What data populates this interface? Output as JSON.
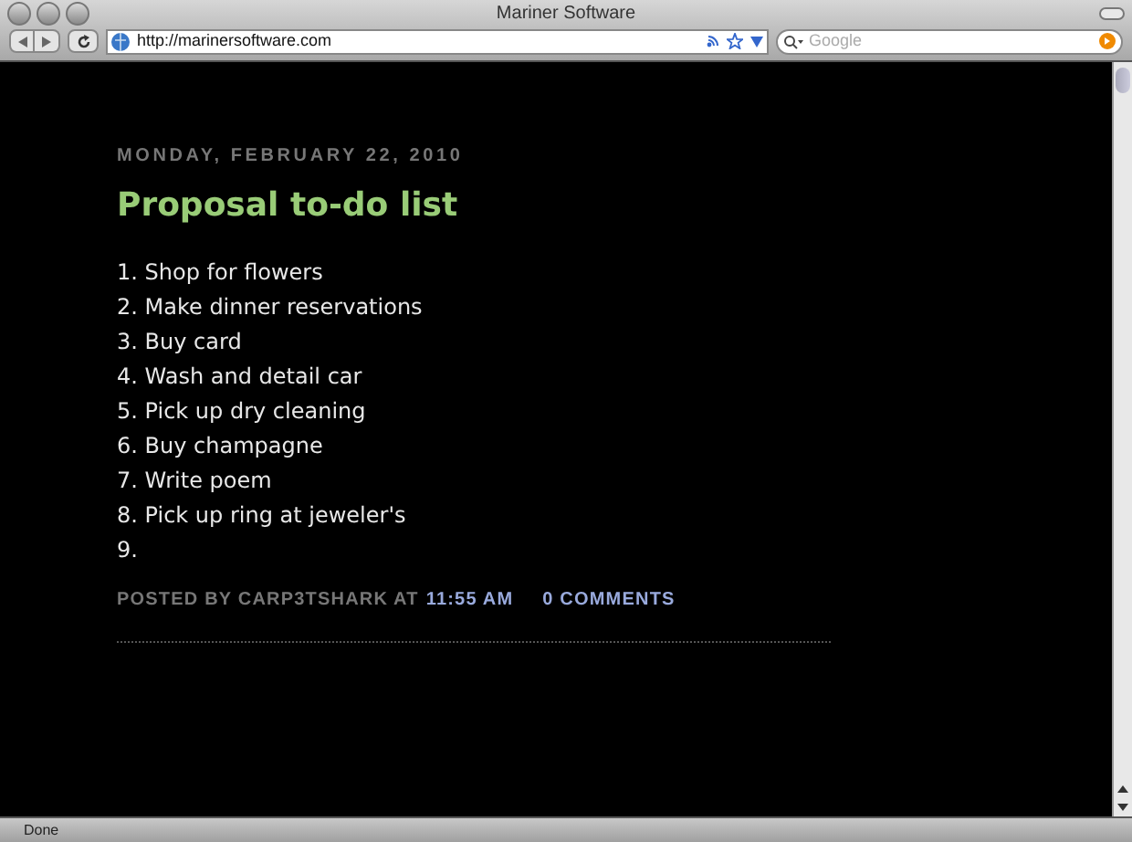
{
  "window": {
    "title": "Mariner Software"
  },
  "toolbar": {
    "url": "http://marinersoftware.com",
    "search": {
      "placeholder": "Google"
    }
  },
  "post": {
    "date": "MONDAY, FEBRUARY 22, 2010",
    "title": "Proposal to-do list",
    "items": [
      "1. Shop for flowers",
      "2. Make dinner reservations",
      "3. Buy card",
      "4. Wash and detail car",
      "5. Pick up dry cleaning",
      "6. Buy champagne",
      "7. Write poem",
      "8. Pick up ring at jeweler's",
      "9."
    ],
    "footer": {
      "posted_by": "POSTED BY CARP3TSHARK AT",
      "time": "11:55 AM",
      "comments": "0 COMMENTS"
    }
  },
  "status_bar": "Done"
}
